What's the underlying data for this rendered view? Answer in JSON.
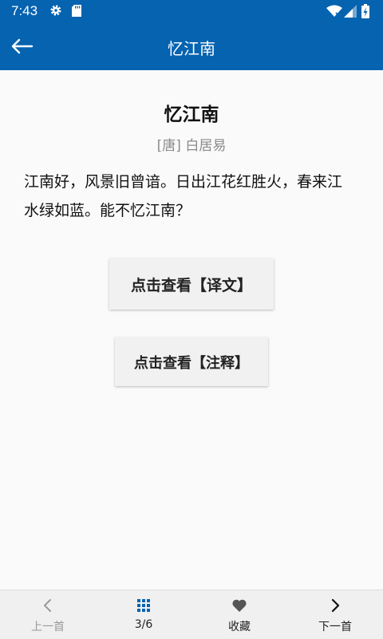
{
  "status_bar": {
    "time": "7:43",
    "icons": [
      "gear-icon",
      "sd-card-icon",
      "wifi-icon",
      "signal-icon",
      "battery-icon"
    ]
  },
  "app_bar": {
    "title": "忆江南",
    "back_icon": "arrow-left-icon",
    "background_color": "#0563b0"
  },
  "poem": {
    "title": "忆江南",
    "author": "[唐] 白居易",
    "lines": [
      "江南好，风景旧曾谙。日出江花红胜火，春来江",
      "水绿如蓝。能不忆江南？"
    ]
  },
  "buttons": {
    "translation_label": "点击查看【译文】",
    "notes_label": "点击查看【注释】"
  },
  "bottom_nav": {
    "prev_label": "上一首",
    "prev_icon": "chevron-left-icon",
    "position_label": "3/6",
    "position_icon": "grid-icon",
    "favorite_label": "收藏",
    "favorite_icon": "heart-icon",
    "next_label": "下一首",
    "next_icon": "chevron-right-icon",
    "accent_color": "#0563b0"
  }
}
